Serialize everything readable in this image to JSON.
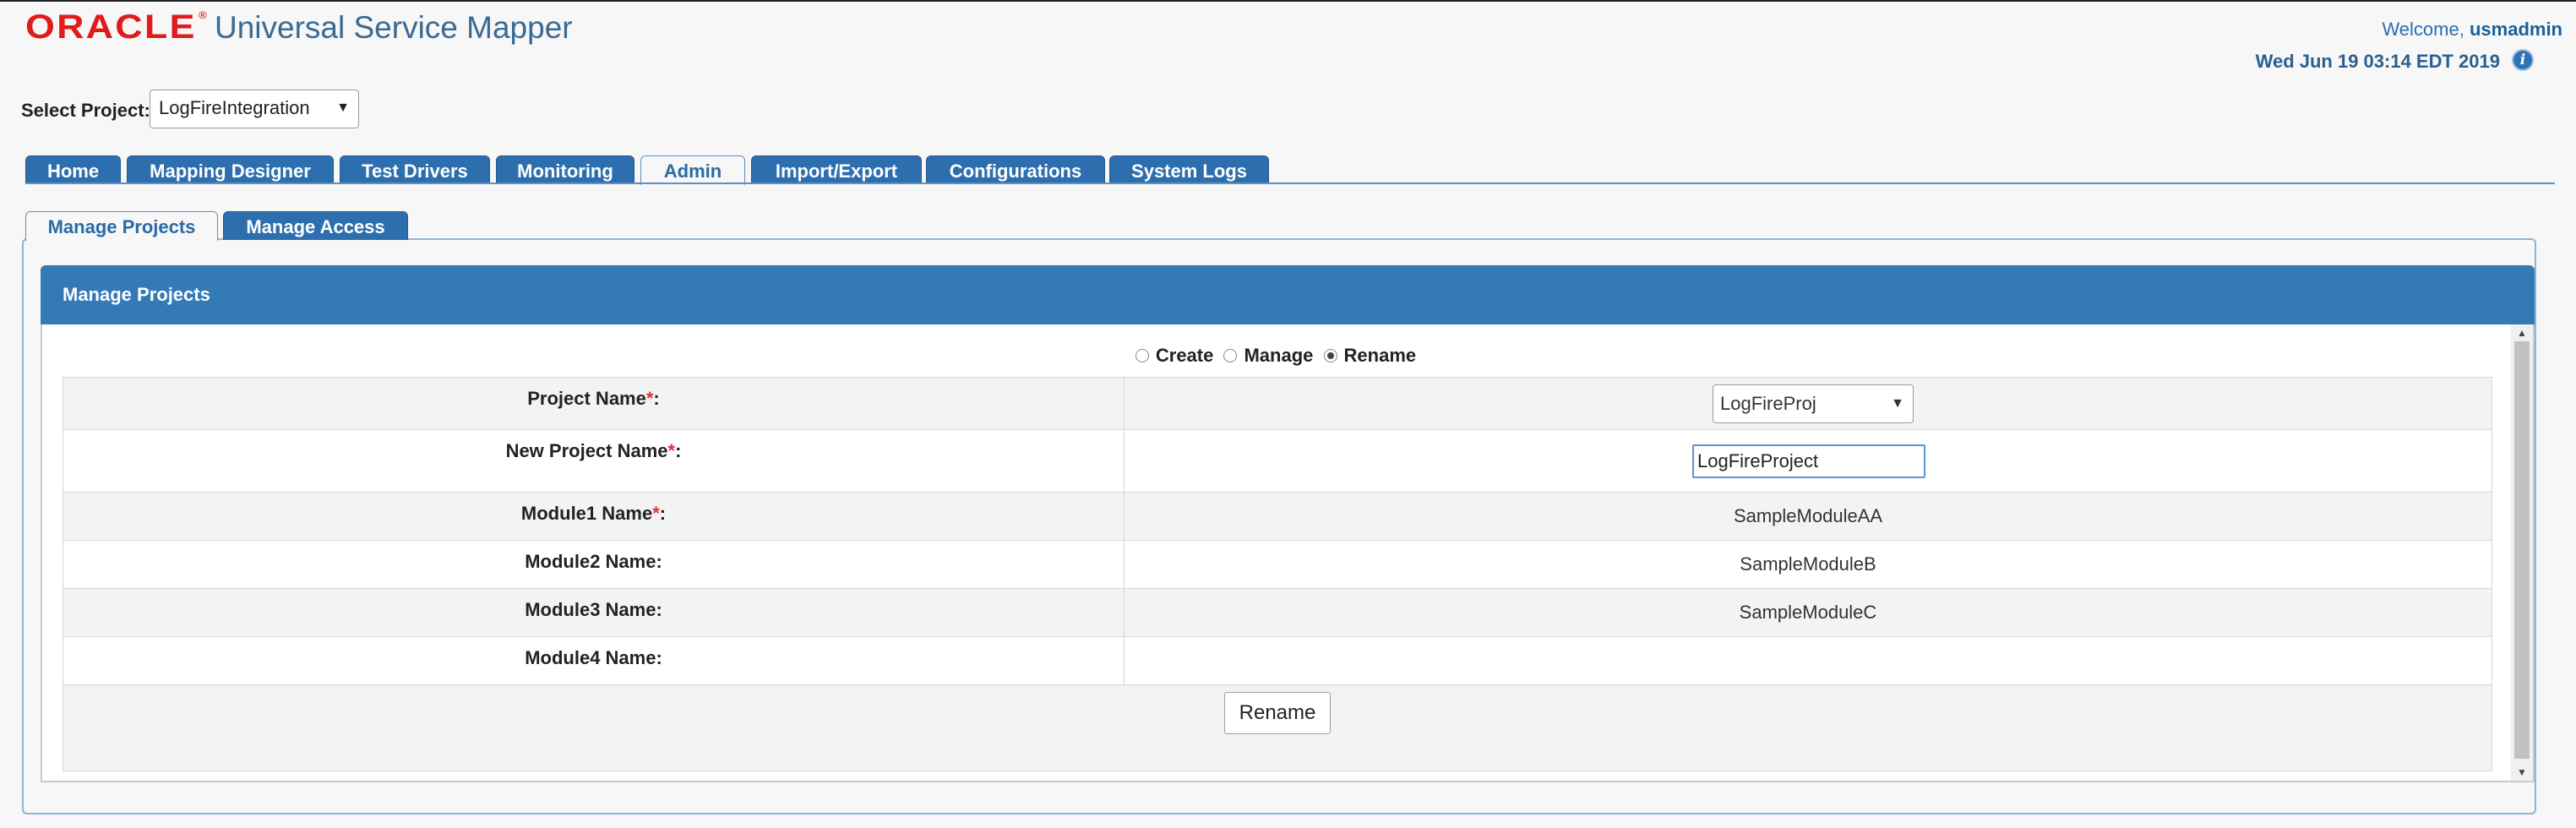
{
  "header": {
    "logo": "ORACLE",
    "app_title": "Universal Service Mapper",
    "welcome_prefix": "Welcome,",
    "username": "usmadmin",
    "datetime": "Wed Jun 19 03:14 EDT 2019"
  },
  "project": {
    "label": "Select Project:",
    "selected": "LogFireIntegration"
  },
  "main_tabs": [
    {
      "label": "Home"
    },
    {
      "label": "Mapping Designer"
    },
    {
      "label": "Test Drivers"
    },
    {
      "label": "Monitoring"
    },
    {
      "label": "Admin",
      "active": true
    },
    {
      "label": "Import/Export"
    },
    {
      "label": "Configurations"
    },
    {
      "label": "System Logs"
    }
  ],
  "sub_tabs": [
    {
      "label": "Manage Projects",
      "active": true
    },
    {
      "label": "Manage Access"
    }
  ],
  "panel": {
    "title": "Manage Projects",
    "radio_options": [
      {
        "label": "Create",
        "checked": false
      },
      {
        "label": "Manage",
        "checked": false
      },
      {
        "label": "Rename",
        "checked": true
      }
    ],
    "rows": [
      {
        "label": "Project Name",
        "required": "*",
        "colon": ":",
        "value": "LogFireProj"
      },
      {
        "label": "New Project Name",
        "required": "*",
        "colon": ":",
        "value": "LogFireProject"
      },
      {
        "label": "Module1 Name",
        "required": "*",
        "colon": ":",
        "value": "SampleModuleAA"
      },
      {
        "label": "Module2 Name",
        "required": "",
        "colon": ":",
        "value": "SampleModuleB"
      },
      {
        "label": "Module3 Name",
        "required": "",
        "colon": ":",
        "value": "SampleModuleC"
      },
      {
        "label": "Module4 Name",
        "required": "",
        "colon": ":",
        "value": ""
      }
    ],
    "rename_button": "Rename"
  }
}
